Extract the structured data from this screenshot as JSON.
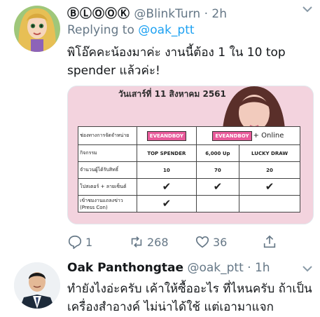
{
  "tweet": {
    "display_name": "ⒷⓁⓄⓄⓀ",
    "handle": "@BlinkTurn",
    "separator": "·",
    "time": "2h",
    "reply_prefix": "Replying to",
    "reply_to": "@oak_ptt",
    "text": "พิโอ๊คคะน้องมาค่ะ งานนี้ต้อง 1 ใน 10 top spender แล้วค่ะ!",
    "image": {
      "date_text": "วันเสาร์ที่ 11 สิงหาคม 2561",
      "table": {
        "header_label": "ช่องทางการจัดจำหน่าย",
        "brand_1": "EVEANDBOY",
        "brand_2": "EVEANDBOY",
        "online_suffix": "+ Online",
        "row_activity_label": "กิจกรรม",
        "activities": [
          "TOP SPENDER",
          "6,000 Up",
          "LUCKY DRAW"
        ],
        "row_count_label": "จำนวนผู้ได้รับสิทธิ์",
        "counts": [
          "10",
          "70",
          "20"
        ],
        "row_poster_label": "โปสเตอร์ + ลายเซ็นต์",
        "row_press_label": "เข้าชมงานแถลงข่าว (Press Con)",
        "check_glyph": "✔"
      }
    },
    "actions": {
      "replies": "1",
      "retweets": "268",
      "likes": "36"
    }
  },
  "reply_tweet": {
    "display_name": "Oak Panthongtae",
    "handle": "@oak_ptt",
    "separator": "·",
    "time": "1h",
    "text": "ทำยังไงอ่ะครับ เค้าให้ซื้ออะไร ที่ไหนครับ ถ้าเป็นเครื่องสำอางค์ ไม่น่าได้ใช้ แต่เอามาแจก"
  },
  "colors": {
    "text": "#14171a",
    "muted": "#657786",
    "link": "#1da1f2",
    "poster_pink": "#f3d3de",
    "brand_pink": "#e85a9a"
  }
}
